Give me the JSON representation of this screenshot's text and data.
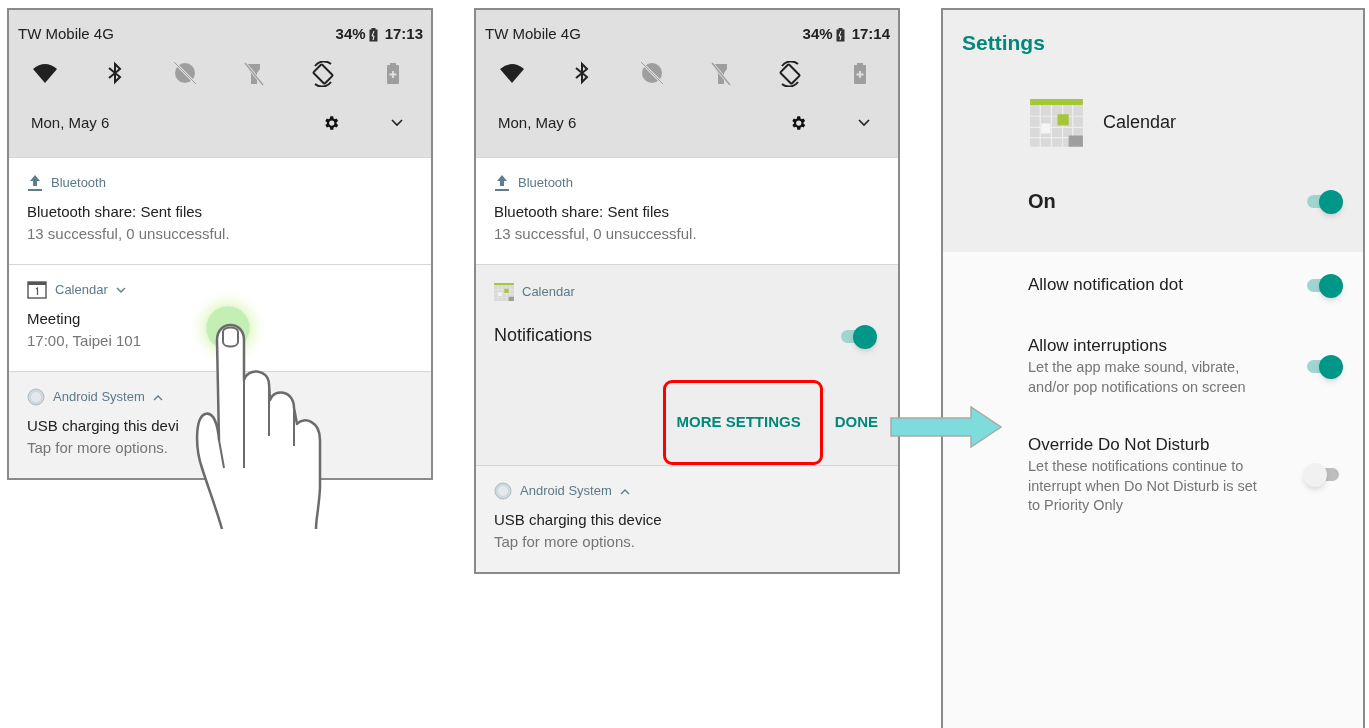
{
  "screens": [
    {
      "kind": "shade",
      "status_bar": {
        "carrier": "TW Mobile 4G",
        "battery": "34%",
        "time": "17:13"
      },
      "quick_tiles": [
        {
          "kind": "wifi",
          "on": true
        },
        {
          "kind": "bluetooth",
          "on": true
        },
        {
          "kind": "dnd",
          "on": false
        },
        {
          "kind": "flashlight",
          "on": false
        },
        {
          "kind": "rotate",
          "on": true
        },
        {
          "kind": "battery_saver",
          "on": false
        }
      ],
      "date": "Mon, May 6",
      "notifications": [
        {
          "kind": "standard",
          "app": "Bluetooth",
          "title": "Bluetooth share: Sent files",
          "text": "13 successful, 0 unsuccessful."
        },
        {
          "kind": "standard",
          "app": "Calendar",
          "expanded": false,
          "title": "Meeting",
          "text": "17:00, Taipei 101"
        },
        {
          "kind": "ongoing",
          "app": "Android System",
          "expanded": true,
          "title": "USB charging this devi",
          "text": "Tap for more options."
        }
      ]
    },
    {
      "kind": "shade",
      "status_bar": {
        "carrier": "TW Mobile 4G",
        "battery": "34%",
        "time": "17:14"
      },
      "quick_tiles": [
        {
          "kind": "wifi",
          "on": true
        },
        {
          "kind": "bluetooth",
          "on": true
        },
        {
          "kind": "dnd",
          "on": false
        },
        {
          "kind": "flashlight",
          "on": false
        },
        {
          "kind": "rotate",
          "on": true
        },
        {
          "kind": "battery_saver",
          "on": false
        }
      ],
      "date": "Mon, May 6",
      "notifications": [
        {
          "kind": "standard",
          "app": "Bluetooth",
          "title": "Bluetooth share: Sent files",
          "text": "13 successful, 0 unsuccessful."
        },
        {
          "kind": "controls",
          "app": "Calendar",
          "toggle": {
            "label": "Notifications",
            "on": true
          },
          "actions": [
            "MORE SETTINGS",
            "DONE"
          ]
        },
        {
          "kind": "ongoing",
          "app": "Android System",
          "expanded": true,
          "title": "USB charging this device",
          "text": "Tap for more options."
        }
      ]
    },
    {
      "kind": "settings",
      "title": "Settings",
      "app": "Calendar",
      "master": {
        "label": "On",
        "on": true
      },
      "items": [
        {
          "label": "Allow notification dot",
          "on": true
        },
        {
          "label": "Allow interruptions",
          "description": "Let the app make sound, vibrate, and/or pop notifications on screen",
          "on": true
        },
        {
          "label": "Override Do Not Disturb",
          "description": "Let these notifications continue to interrupt when Do Not Disturb is set to Priority Only",
          "on": false
        }
      ]
    }
  ]
}
